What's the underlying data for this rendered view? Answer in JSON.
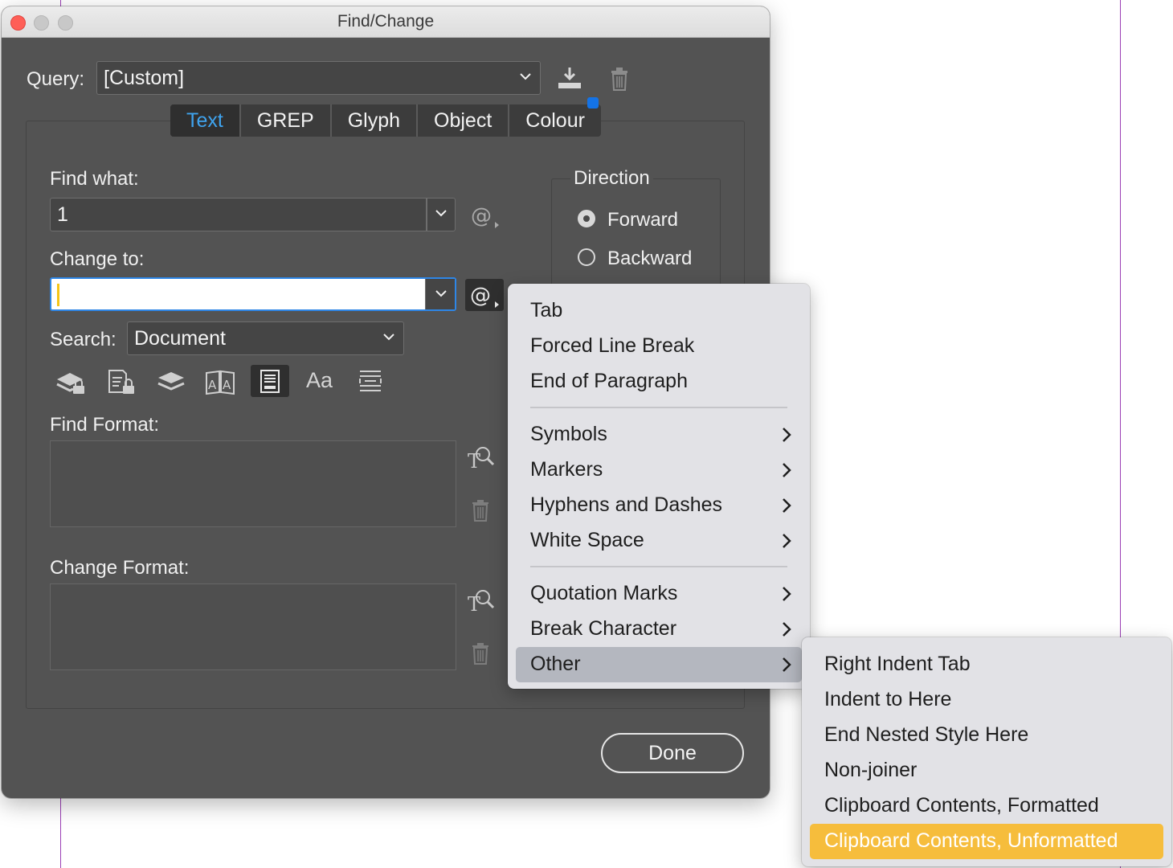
{
  "window": {
    "title": "Find/Change"
  },
  "query": {
    "label": "Query:",
    "value": "[Custom]"
  },
  "tabs": [
    {
      "label": "Text",
      "active": true
    },
    {
      "label": "GREP",
      "active": false
    },
    {
      "label": "Glyph",
      "active": false
    },
    {
      "label": "Object",
      "active": false
    },
    {
      "label": "Colour",
      "active": false
    }
  ],
  "find": {
    "label": "Find what:",
    "value": "1"
  },
  "change": {
    "label": "Change to:",
    "value": ""
  },
  "search": {
    "label": "Search:",
    "value": "Document"
  },
  "direction": {
    "label": "Direction",
    "forward": "Forward",
    "backward": "Backward",
    "selected": "Forward"
  },
  "options": {
    "case_label": "Aa"
  },
  "find_format": {
    "label": "Find Format:"
  },
  "change_format": {
    "label": "Change Format:"
  },
  "done_label": "Done",
  "special_menu": {
    "items": [
      "Tab",
      "Forced Line Break",
      "End of Paragraph",
      "Symbols",
      "Markers",
      "Hyphens and Dashes",
      "White Space",
      "Quotation Marks",
      "Break Character",
      "Other"
    ],
    "highlighted": "Other"
  },
  "other_submenu": {
    "items": [
      "Right Indent Tab",
      "Indent to Here",
      "End Nested Style Here",
      "Non-joiner",
      "Clipboard Contents, Formatted",
      "Clipboard Contents, Unformatted"
    ],
    "selected": "Clipboard Contents, Unformatted"
  },
  "colors": {
    "accent": "#3fa3ee",
    "selection": "#f6bd3c",
    "caret": "#f5c518",
    "focus_ring": "#2e86e6"
  }
}
